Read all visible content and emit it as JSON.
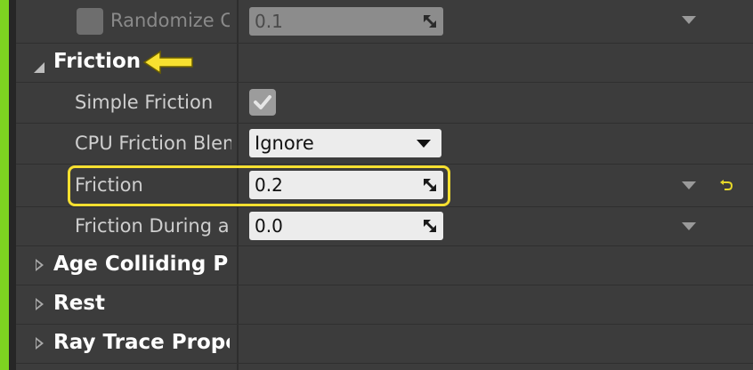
{
  "colors": {
    "panel_bg": "#3c3c3c",
    "accent": "#7ed321",
    "highlight": "#f7e030",
    "field_bg": "#ececec",
    "reset_icon": "#e6d829"
  },
  "rows": {
    "randomize": {
      "label": "Randomize Co",
      "value": "0.1",
      "checked": false
    },
    "friction_category": {
      "label": "Friction",
      "expanded": true
    },
    "simple_friction": {
      "label": "Simple Friction",
      "checked": true
    },
    "cpu_friction_blend": {
      "label": "CPU Friction Blend",
      "value": "Ignore"
    },
    "friction": {
      "label": "Friction",
      "value": "0.2"
    },
    "friction_during_a": {
      "label": "Friction During a E",
      "value": "0.0"
    },
    "age_colliding": {
      "label": "Age Colliding Pa",
      "expanded": false
    },
    "rest": {
      "label": "Rest",
      "expanded": false
    },
    "ray_trace": {
      "label": "Ray Trace Proper",
      "expanded": false
    }
  },
  "icons": {
    "expand_open": "triangle-down-icon",
    "expand_closed": "triangle-right-icon",
    "field_resize": "resize-arrows-icon",
    "reset_to_default": "reset-arrow-icon",
    "callout": "yellow-left-arrow-icon",
    "checkmark": "checkmark-icon",
    "dropdown": "chevron-down-icon"
  }
}
